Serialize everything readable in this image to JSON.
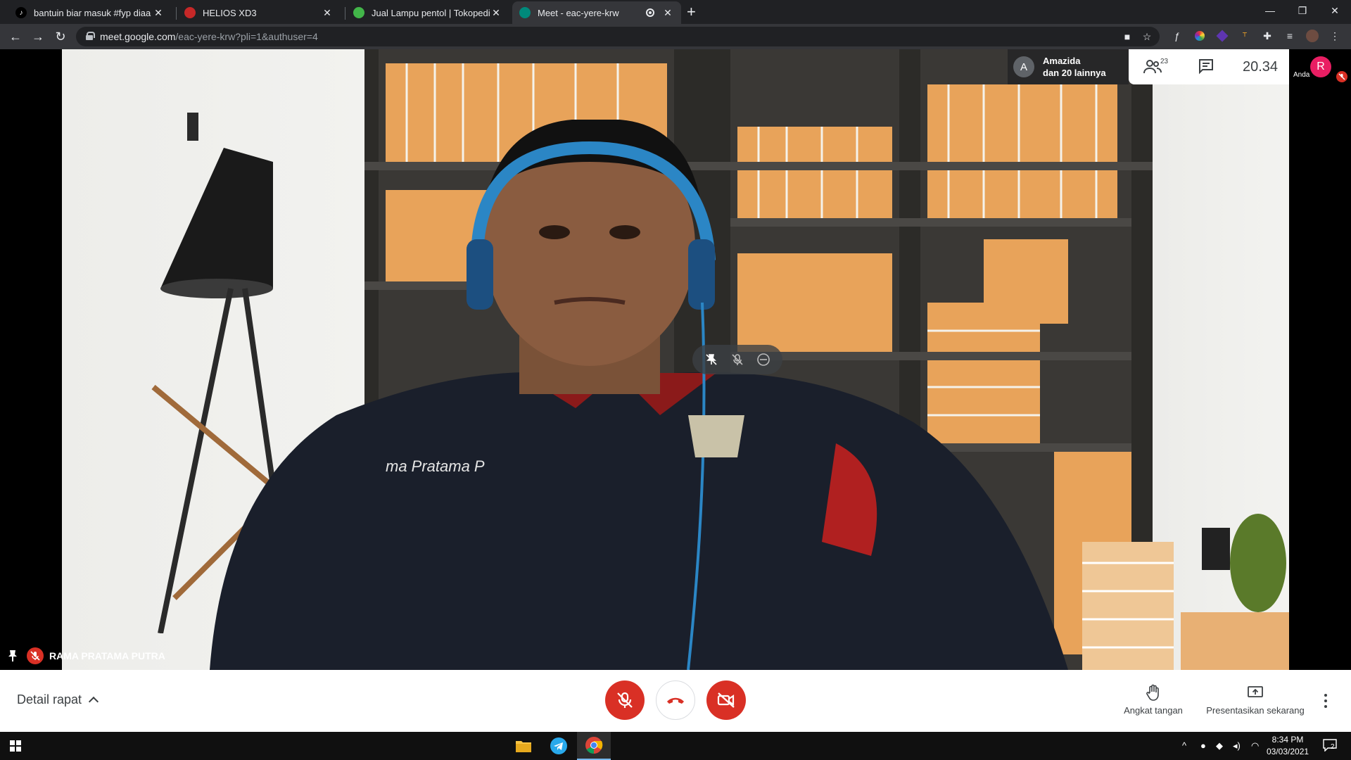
{
  "browser": {
    "tabs": [
      {
        "title": "bantuin biar masuk #fyp diaa",
        "favicon": "tiktok-icon",
        "color": "#000000"
      },
      {
        "title": "HELIOS XD3",
        "favicon": "helios-icon",
        "color": "#c62828"
      },
      {
        "title": "Jual Lampu pentol | Tokopedia",
        "favicon": "tokopedia-icon",
        "color": "#42b549"
      },
      {
        "title": "Meet - eac-yere-krw",
        "favicon": "meet-icon",
        "color": "#00897b"
      }
    ],
    "url_host": "meet.google.com",
    "url_path": "/eac-yere-krw?pli=1&authuser=4"
  },
  "meet": {
    "participant_name": "RAMA PRATAMA PUTRA",
    "presenter_initial": "A",
    "presenter_line1": "Amazida",
    "presenter_line2": "dan 20 lainnya",
    "participant_count": "23",
    "time": "20.34",
    "self_initial": "R",
    "self_label": "Anda",
    "shirt_text": "ma Pratama P",
    "details_label": "Detail rapat",
    "raise_hand_label": "Angkat tangan",
    "present_label": "Presentasikan sekarang"
  },
  "taskbar": {
    "time": "8:34 PM",
    "date": "03/03/2021",
    "notifications": "2",
    "apps": [
      "file-explorer-icon",
      "telegram-icon",
      "chrome-icon"
    ]
  },
  "colors": {
    "danger": "#d93025",
    "chrome_dark": "#202124",
    "chrome_toolbar": "#35363a"
  }
}
